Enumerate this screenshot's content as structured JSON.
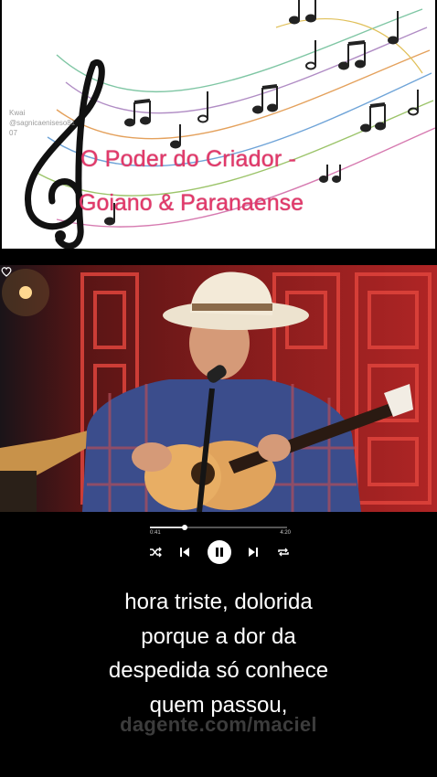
{
  "banner": {
    "watermark_brand": "Kwai",
    "watermark_handle": "@sagnicaeniseso81",
    "watermark_id": "07",
    "title": "O Poder do Criador -",
    "artist": "Goiano & Paranaense"
  },
  "player": {
    "elapsed": "0:41",
    "total": "4:20",
    "progress_fraction": 0.25,
    "state": "paused"
  },
  "lyrics": [
    "hora triste, dolorida",
    "porque a dor da",
    "despedida só conhece",
    "quem passou,"
  ],
  "site_watermark": "dagente.com/maciel",
  "colors": {
    "title": "#e2396a",
    "background": "#000000",
    "lyrics": "#ffffff"
  }
}
